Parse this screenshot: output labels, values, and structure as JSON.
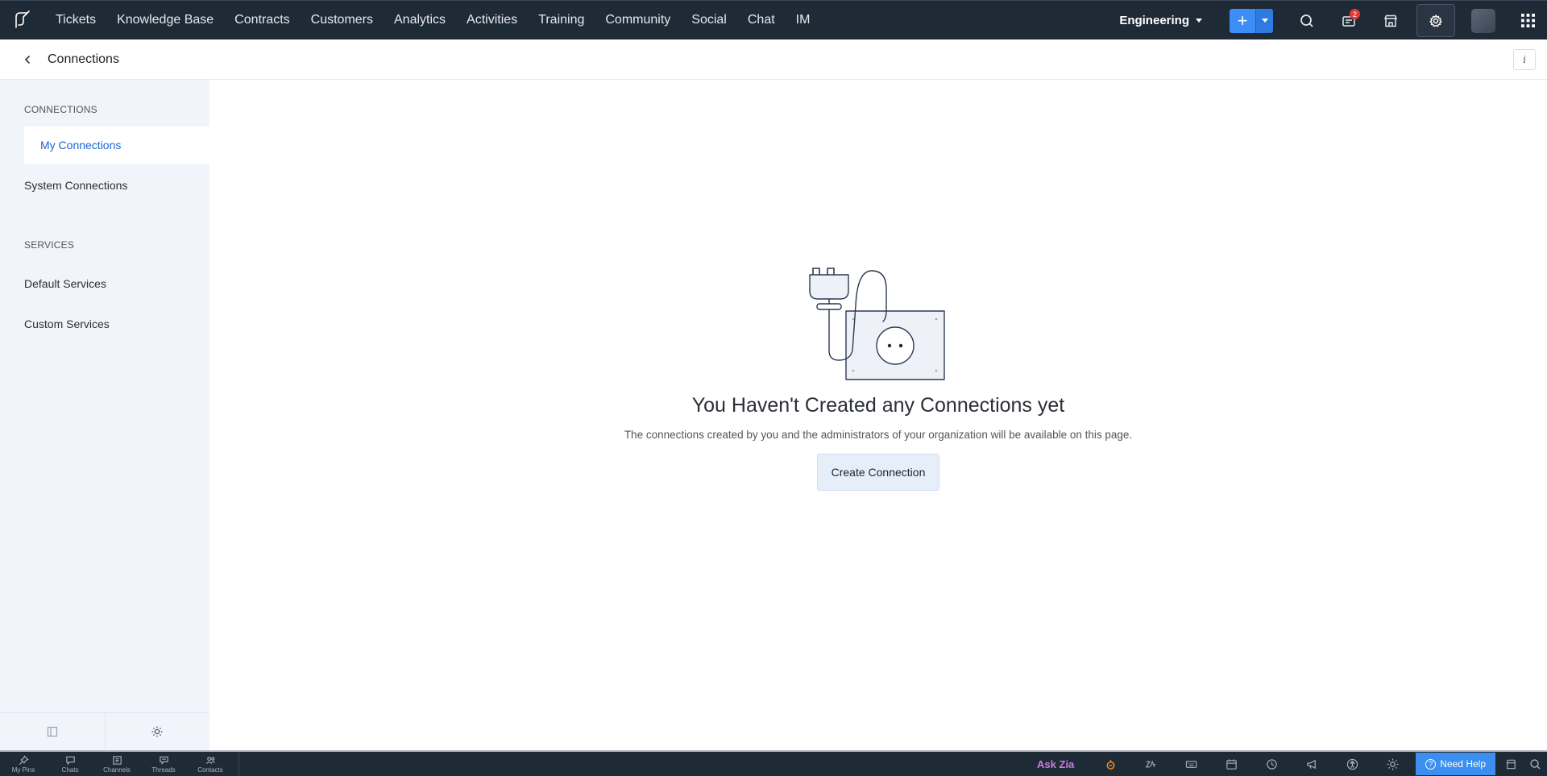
{
  "nav": {
    "items": [
      "Tickets",
      "Knowledge Base",
      "Contracts",
      "Customers",
      "Analytics",
      "Activities",
      "Training",
      "Community",
      "Social",
      "Chat",
      "IM"
    ],
    "department": "Engineering",
    "notification_count": "2"
  },
  "header": {
    "title": "Connections",
    "info": "i"
  },
  "sidebar": {
    "section_connections": "CONNECTIONS",
    "my_connections": "My Connections",
    "system_connections": "System Connections",
    "section_services": "SERVICES",
    "default_services": "Default Services",
    "custom_services": "Custom Services"
  },
  "empty_state": {
    "title": "You Haven't Created any Connections yet",
    "description": "The connections created by you and the administrators of your organization will be available on this page.",
    "button": "Create Connection"
  },
  "bottom_bar": {
    "tabs": [
      "My Pins",
      "Chats",
      "Channels",
      "Threads",
      "Contacts"
    ],
    "ask_zia": "Ask Zia",
    "need_help": "Need Help"
  },
  "colors": {
    "nav_bg": "#1f2a37",
    "accent": "#3c8df5",
    "active_link": "#1a66d1",
    "sidebar_bg": "#f1f5fb",
    "badge": "#e53935"
  }
}
